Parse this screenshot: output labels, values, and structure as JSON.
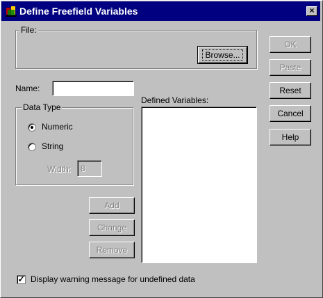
{
  "window": {
    "title": "Define Freefield Variables",
    "close_glyph": "×"
  },
  "file_group": {
    "label": "File:",
    "browse_label": "Browse..."
  },
  "name": {
    "label": "Name:",
    "value": ""
  },
  "data_type": {
    "label": "Data Type",
    "numeric_label": "Numeric",
    "string_label": "String",
    "selected": "Numeric",
    "width_label": "Width:",
    "width_value": "8"
  },
  "defined_variables": {
    "label": "Defined Variables:",
    "items": []
  },
  "actions": {
    "add_label": "Add",
    "change_label": "Change",
    "remove_label": "Remove"
  },
  "dialog_buttons": {
    "ok_label": "OK",
    "paste_label": "Paste",
    "reset_label": "Reset",
    "cancel_label": "Cancel",
    "help_label": "Help"
  },
  "warning": {
    "label": "Display warning message for undefined data",
    "checked": true
  }
}
